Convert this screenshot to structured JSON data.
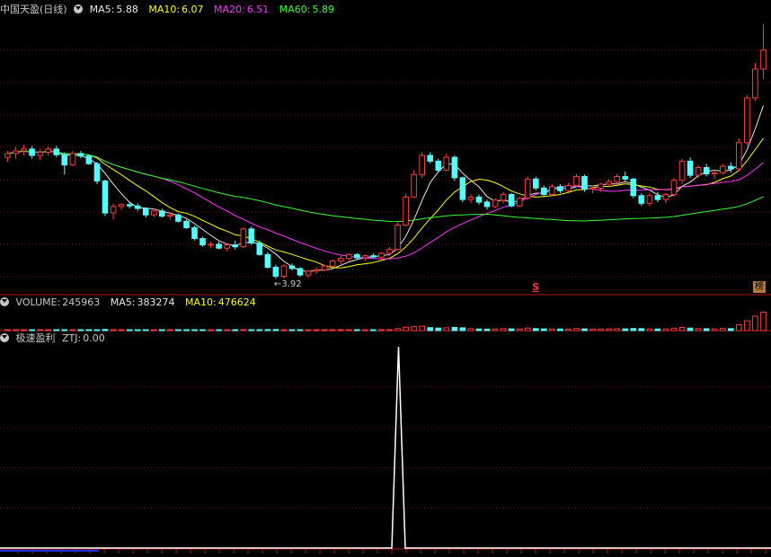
{
  "colors": {
    "up": "#ff3c3c",
    "down": "#54ffff",
    "ma5": "#e6e6e6",
    "ma10": "#ffff00",
    "ma20": "#ff33ff",
    "ma60": "#33ff33",
    "text": "#c8c8c8",
    "grid": "#7a1010",
    "ztj": "#ffffff"
  },
  "price_panel": {
    "stock_name": "中国天盈",
    "period": "(日线)",
    "ma5_label": "MA5:",
    "ma5_value": "5.88",
    "ma10_label": "MA10:",
    "ma10_value": "6.07",
    "ma20_label": "MA20:",
    "ma20_value": "6.51",
    "ma60_label": "MA60:",
    "ma60_value": "5.89",
    "low_annotation": "3.92",
    "signal_mark": "S",
    "rank_badge": "榜"
  },
  "volume_panel": {
    "label": "VOLUME:",
    "value": "245963",
    "ma5_label": "MA5:",
    "ma5_value": "383274",
    "ma10_label": "MA10:",
    "ma10_value": "476624"
  },
  "indicator_panel": {
    "name": "极速盈利",
    "ztj_label": "ZTJ:",
    "ztj_value": "0.00"
  },
  "chart_data": [
    {
      "type": "candlestick",
      "title": "中国天盈 (日线)",
      "ylim": [
        3.7,
        8.0
      ],
      "candles": [
        [
          5.82,
          5.92,
          5.75,
          5.88
        ],
        [
          5.88,
          5.98,
          5.8,
          5.92
        ],
        [
          5.92,
          6.02,
          5.85,
          5.95
        ],
        [
          5.95,
          6.0,
          5.8,
          5.85
        ],
        [
          5.85,
          5.95,
          5.78,
          5.9
        ],
        [
          5.9,
          6.0,
          5.85,
          5.95
        ],
        [
          5.95,
          6.0,
          5.82,
          5.86
        ],
        [
          5.86,
          5.9,
          5.55,
          5.7
        ],
        [
          5.7,
          5.92,
          5.68,
          5.88
        ],
        [
          5.88,
          5.92,
          5.8,
          5.84
        ],
        [
          5.84,
          5.86,
          5.7,
          5.72
        ],
        [
          5.72,
          5.75,
          5.4,
          5.45
        ],
        [
          5.45,
          5.47,
          4.9,
          4.95
        ],
        [
          4.95,
          5.1,
          4.85,
          5.05
        ],
        [
          5.05,
          5.1,
          5.0,
          5.08
        ],
        [
          5.08,
          5.12,
          5.02,
          5.06
        ],
        [
          5.06,
          5.1,
          4.98,
          5.02
        ],
        [
          5.02,
          5.04,
          4.88,
          4.92
        ],
        [
          4.92,
          5.02,
          4.88,
          4.98
        ],
        [
          4.98,
          5.02,
          4.88,
          4.9
        ],
        [
          4.9,
          4.96,
          4.84,
          4.92
        ],
        [
          4.92,
          4.94,
          4.8,
          4.82
        ],
        [
          4.82,
          4.85,
          4.7,
          4.72
        ],
        [
          4.72,
          4.75,
          4.52,
          4.55
        ],
        [
          4.55,
          4.58,
          4.42,
          4.45
        ],
        [
          4.45,
          4.5,
          4.4,
          4.46
        ],
        [
          4.46,
          4.5,
          4.38,
          4.4
        ],
        [
          4.4,
          4.48,
          4.35,
          4.45
        ],
        [
          4.45,
          4.52,
          4.38,
          4.42
        ],
        [
          4.42,
          4.72,
          4.4,
          4.7
        ],
        [
          4.7,
          4.74,
          4.45,
          4.48
        ],
        [
          4.48,
          4.52,
          4.28,
          4.3
        ],
        [
          4.3,
          4.34,
          4.08,
          4.1
        ],
        [
          4.1,
          4.14,
          3.92,
          3.96
        ],
        [
          3.96,
          4.15,
          3.92,
          4.12
        ],
        [
          4.12,
          4.16,
          4.05,
          4.08
        ],
        [
          4.08,
          4.1,
          3.95,
          3.98
        ],
        [
          3.98,
          4.06,
          3.94,
          4.04
        ],
        [
          4.04,
          4.1,
          4.0,
          4.06
        ],
        [
          4.06,
          4.14,
          4.04,
          4.12
        ],
        [
          4.12,
          4.22,
          4.1,
          4.2
        ],
        [
          4.2,
          4.28,
          4.15,
          4.24
        ],
        [
          4.24,
          4.32,
          4.2,
          4.3
        ],
        [
          4.3,
          4.32,
          4.22,
          4.25
        ],
        [
          4.25,
          4.3,
          4.2,
          4.28
        ],
        [
          4.28,
          4.32,
          4.24,
          4.26
        ],
        [
          4.26,
          4.34,
          4.22,
          4.32
        ],
        [
          4.32,
          4.42,
          4.28,
          4.38
        ],
        [
          4.38,
          4.8,
          4.36,
          4.76
        ],
        [
          4.76,
          5.25,
          4.74,
          5.2
        ],
        [
          5.2,
          5.62,
          5.18,
          5.55
        ],
        [
          5.55,
          5.9,
          5.5,
          5.85
        ],
        [
          5.85,
          5.9,
          5.72,
          5.76
        ],
        [
          5.76,
          5.8,
          5.58,
          5.62
        ],
        [
          5.62,
          5.88,
          5.6,
          5.82
        ],
        [
          5.82,
          5.85,
          5.45,
          5.5
        ],
        [
          5.5,
          5.52,
          5.12,
          5.16
        ],
        [
          5.16,
          5.24,
          5.1,
          5.2
        ],
        [
          5.2,
          5.24,
          5.08,
          5.12
        ],
        [
          5.12,
          5.16,
          5.0,
          5.05
        ],
        [
          5.05,
          5.18,
          5.02,
          5.15
        ],
        [
          5.15,
          5.28,
          5.1,
          5.24
        ],
        [
          5.24,
          5.26,
          5.04,
          5.06
        ],
        [
          5.06,
          5.2,
          5.04,
          5.18
        ],
        [
          5.18,
          5.52,
          5.16,
          5.48
        ],
        [
          5.48,
          5.52,
          5.3,
          5.34
        ],
        [
          5.34,
          5.38,
          5.2,
          5.24
        ],
        [
          5.24,
          5.4,
          5.22,
          5.36
        ],
        [
          5.36,
          5.4,
          5.26,
          5.3
        ],
        [
          5.3,
          5.42,
          5.28,
          5.38
        ],
        [
          5.38,
          5.56,
          5.36,
          5.52
        ],
        [
          5.52,
          5.55,
          5.28,
          5.32
        ],
        [
          5.32,
          5.38,
          5.26,
          5.34
        ],
        [
          5.34,
          5.42,
          5.28,
          5.4
        ],
        [
          5.4,
          5.48,
          5.36,
          5.44
        ],
        [
          5.44,
          5.56,
          5.4,
          5.52
        ],
        [
          5.52,
          5.6,
          5.44,
          5.48
        ],
        [
          5.48,
          5.5,
          5.18,
          5.22
        ],
        [
          5.22,
          5.26,
          5.06,
          5.1
        ],
        [
          5.1,
          5.26,
          5.06,
          5.22
        ],
        [
          5.22,
          5.28,
          5.12,
          5.16
        ],
        [
          5.16,
          5.26,
          5.1,
          5.24
        ],
        [
          5.24,
          5.5,
          5.2,
          5.46
        ],
        [
          5.46,
          5.8,
          5.4,
          5.76
        ],
        [
          5.76,
          5.82,
          5.5,
          5.54
        ],
        [
          5.54,
          5.7,
          5.5,
          5.66
        ],
        [
          5.66,
          5.72,
          5.52,
          5.56
        ],
        [
          5.56,
          5.62,
          5.48,
          5.58
        ],
        [
          5.58,
          5.72,
          5.55,
          5.68
        ],
        [
          5.68,
          5.74,
          5.58,
          5.64
        ],
        [
          5.64,
          6.12,
          5.6,
          6.05
        ],
        [
          6.05,
          6.8,
          6.0,
          6.75
        ],
        [
          6.75,
          7.3,
          6.7,
          7.2
        ],
        [
          7.2,
          7.9,
          7.05,
          7.5
        ]
      ],
      "ma_params": [
        5,
        10,
        20,
        60
      ],
      "annotations": [
        {
          "label": "3.92",
          "type": "low"
        }
      ]
    },
    {
      "type": "bar",
      "title": "VOLUME",
      "ylim": [
        0,
        3000000
      ],
      "values": [
        80000,
        90000,
        85000,
        70000,
        75000,
        80000,
        95000,
        120000,
        90000,
        70000,
        90000,
        110000,
        180000,
        120000,
        70000,
        60000,
        65000,
        80000,
        70000,
        75000,
        65000,
        80000,
        95000,
        120000,
        110000,
        80000,
        75000,
        70000,
        80000,
        160000,
        120000,
        130000,
        150000,
        170000,
        140000,
        90000,
        85000,
        80000,
        75000,
        85000,
        95000,
        100000,
        110000,
        80000,
        75000,
        70000,
        85000,
        110000,
        300000,
        520000,
        600000,
        650000,
        450000,
        380000,
        420000,
        480000,
        420000,
        300000,
        250000,
        220000,
        240000,
        280000,
        260000,
        240000,
        380000,
        300000,
        260000,
        250000,
        240000,
        230000,
        300000,
        260000,
        220000,
        230000,
        250000,
        280000,
        260000,
        320000,
        300000,
        260000,
        250000,
        260000,
        350000,
        480000,
        380000,
        300000,
        280000,
        260000,
        320000,
        300000,
        900000,
        1500000,
        2200000,
        2800000
      ]
    },
    {
      "type": "line",
      "title": "极速盈利",
      "series": [
        {
          "name": "ZTJ",
          "x_index": [
            45,
            46,
            47
          ],
          "values": [
            0,
            1,
            0
          ]
        }
      ],
      "ylim": [
        0,
        1
      ]
    }
  ]
}
